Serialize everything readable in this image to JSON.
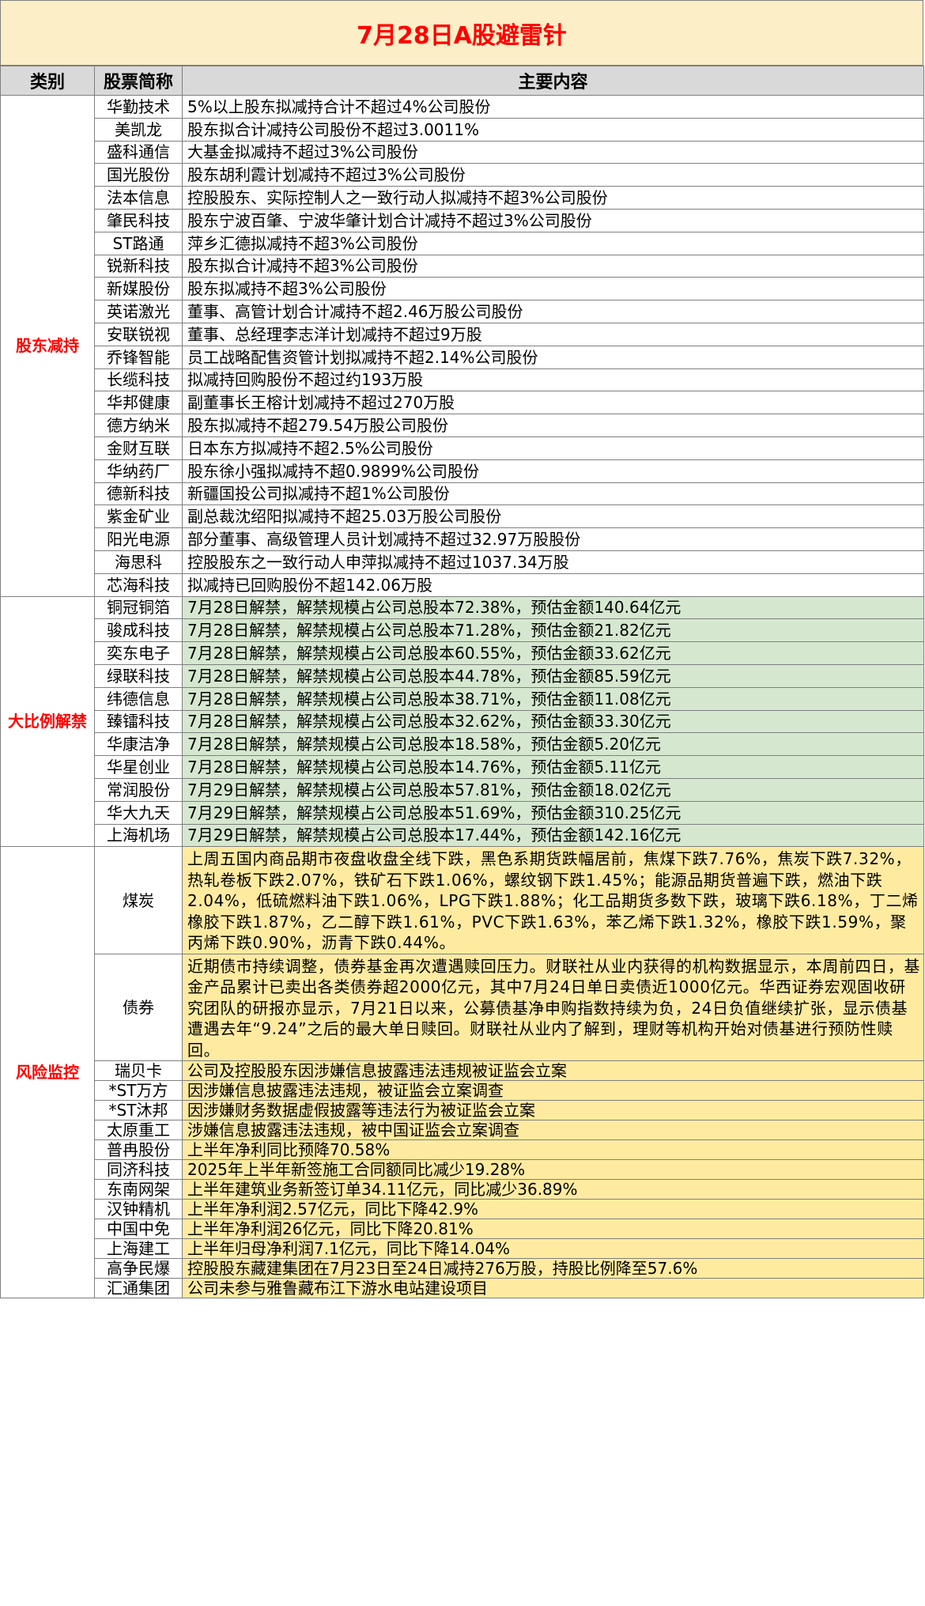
{
  "title": "7月28日A股避雷针",
  "headers": [
    "类别",
    "股票简称",
    "主要内容"
  ],
  "groups": [
    {
      "category": "股东减持",
      "rows": [
        {
          "name": "华勤技术",
          "content": "5%以上股东拟减持合计不超过4%公司股份"
        },
        {
          "name": "美凯龙",
          "content": "股东拟合计减持公司股份不超过3.0011%"
        },
        {
          "name": "盛科通信",
          "content": "大基金拟减持不超过3%公司股份"
        },
        {
          "name": "国光股份",
          "content": "股东胡利霞计划减持不超过3%公司股份"
        },
        {
          "name": "法本信息",
          "content": "控股股东、实际控制人之一致行动人拟减持不超3%公司股份"
        },
        {
          "name": "肇民科技",
          "content": "股东宁波百肇、宁波华肇计划合计减持不超过3%公司股份"
        },
        {
          "name": "ST路通",
          "content": "萍乡汇德拟减持不超3%公司股份"
        },
        {
          "name": "锐新科技",
          "content": "股东拟合计减持不超3%公司股份"
        },
        {
          "name": "新媒股份",
          "content": "股东拟减持不超3%公司股份"
        },
        {
          "name": "英诺激光",
          "content": "董事、高管计划合计减持不超2.46万股公司股份"
        },
        {
          "name": "安联锐视",
          "content": "董事、总经理李志洋计划减持不超过9万股"
        },
        {
          "name": "乔锋智能",
          "content": "员工战略配售资管计划拟减持不超2.14%公司股份"
        },
        {
          "name": "长缆科技",
          "content": "拟减持回购股份不超过约193万股"
        },
        {
          "name": "华邦健康",
          "content": "副董事长王榕计划减持不超过270万股"
        },
        {
          "name": "德方纳米",
          "content": "股东拟减持不超279.54万股公司股份"
        },
        {
          "name": "金财互联",
          "content": "日本东方拟减持不超2.5%公司股份"
        },
        {
          "name": "华纳药厂",
          "content": "股东徐小强拟减持不超0.9899%公司股份"
        },
        {
          "name": "德新科技",
          "content": "新疆国投公司拟减持不超1%公司股份"
        },
        {
          "name": "紫金矿业",
          "content": "副总裁沈绍阳拟减持不超25.03万股公司股份"
        },
        {
          "name": "阳光电源",
          "content": "部分董事、高级管理人员计划减持不超过32.97万股股份"
        },
        {
          "name": "海思科",
          "content": "控股股东之一致行动人申萍拟减持不超过1037.34万股"
        },
        {
          "name": "芯海科技",
          "content": "拟减持已回购股份不超142.06万股"
        }
      ]
    },
    {
      "category": "大比例解禁",
      "rows": [
        {
          "name": "铜冠铜箔",
          "content": "7月28日解禁，解禁规模占公司总股本72.38%，预估金额140.64亿元"
        },
        {
          "name": "骏成科技",
          "content": "7月28日解禁，解禁规模占公司总股本71.28%，预估金额21.82亿元"
        },
        {
          "name": "奕东电子",
          "content": "7月28日解禁，解禁规模占公司总股本60.55%，预估金额33.62亿元"
        },
        {
          "name": "绿联科技",
          "content": "7月28日解禁，解禁规模占公司总股本44.78%，预估金额85.59亿元"
        },
        {
          "name": "纬德信息",
          "content": "7月28日解禁，解禁规模占公司总股本38.71%，预估金额11.08亿元"
        },
        {
          "name": "臻镭科技",
          "content": "7月28日解禁，解禁规模占公司总股本32.62%，预估金额33.30亿元"
        },
        {
          "name": "华康洁净",
          "content": "7月28日解禁，解禁规模占公司总股本18.58%，预估金额5.20亿元"
        },
        {
          "name": "华星创业",
          "content": "7月28日解禁，解禁规模占公司总股本14.76%，预估金额5.11亿元"
        },
        {
          "name": "常润股份",
          "content": "7月29日解禁，解禁规模占公司总股本57.81%，预估金额18.02亿元"
        },
        {
          "name": "华大九天",
          "content": "7月29日解禁，解禁规模占公司总股本51.69%，预估金额310.25亿元"
        },
        {
          "name": "上海机场",
          "content": "7月29日解禁，解禁规模占公司总股本17.44%，预估金额142.16亿元"
        }
      ]
    },
    {
      "category": "风险监控",
      "rows": [
        {
          "name": "煤炭",
          "content": "上周五国内商品期市夜盘收盘全线下跌，黑色系期货跌幅居前，焦煤下跌7.76%，焦炭下跌7.32%，热轧卷板下跌2.07%，铁矿石下跌1.06%，螺纹钢下跌1.45%；能源品期货普遍下跌，燃油下跌2.04%，低硫燃料油下跌1.06%，LPG下跌1.88%；化工品期货多数下跌，玻璃下跌6.18%，丁二烯橡胶下跌1.87%，乙二醇下跌1.61%，PVC下跌1.63%，苯乙烯下跌1.32%，橡胶下跌1.59%，聚丙烯下跌0.90%，沥青下跌0.44%。"
        },
        {
          "name": "债券",
          "content": "近期债市持续调整，债券基金再次遭遇赎回压力。财联社从业内获得的机构数据显示，本周前四日，基金产品累计已卖出各类债券超2000亿元，其中7月24日单日卖债近1000亿元。华西证券宏观固收研究团队的研报亦显示，7月21日以来，公募债基净申购指数持续为负，24日负值继续扩张，显示债基遭遇去年“9.24”之后的最大单日赎回。财联社从业内了解到，理财等机构开始对债基进行预防性赎回。"
        },
        {
          "name": "瑞贝卡",
          "content": "公司及控股股东因涉嫌信息披露违法违规被证监会立案"
        },
        {
          "name": "*ST万方",
          "content": "因涉嫌信息披露违法违规，被证监会立案调查"
        },
        {
          "name": "*ST沐邦",
          "content": "因涉嫌财务数据虚假披露等违法行为被证监会立案"
        },
        {
          "name": "太原重工",
          "content": "涉嫌信息披露违法违规，被中国证监会立案调查"
        },
        {
          "name": "普冉股份",
          "content": "上半年净利同比预降70.58%"
        },
        {
          "name": "同济科技",
          "content": "2025年上半年新签施工合同额同比减少19.28%"
        },
        {
          "name": "东南网架",
          "content": "上半年建筑业务新签订单34.11亿元，同比减少36.89%"
        },
        {
          "name": "汉钟精机",
          "content": "上半年净利润2.57亿元，同比下降42.9%"
        },
        {
          "name": "中国中免",
          "content": "上半年净利润26亿元，同比下降20.81%"
        },
        {
          "name": "上海建工",
          "content": "上半年归母净利润7.1亿元，同比下降14.04%"
        },
        {
          "name": "高争民爆",
          "content": "控股股东藏建集团在7月23日至24日减持276万股，持股比例降至57.6%"
        },
        {
          "name": "汇通集团",
          "content": "公司未参与雅鲁藏布江下游水电站建设项目"
        }
      ]
    }
  ]
}
